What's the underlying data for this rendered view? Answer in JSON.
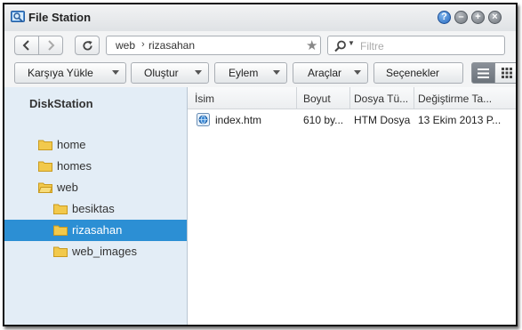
{
  "window": {
    "title": "File Station"
  },
  "nav": {
    "path": [
      "web",
      "rizasahan"
    ],
    "search_placeholder": "Filtre"
  },
  "toolbar": {
    "upload_label": "Karşıya Yükle",
    "create_label": "Oluştur",
    "action_label": "Eylem",
    "tools_label": "Araçlar",
    "settings_label": "Seçenekler"
  },
  "sidebar": {
    "root": "DiskStation",
    "items": [
      {
        "label": "home"
      },
      {
        "label": "homes"
      },
      {
        "label": "web"
      },
      {
        "label": "besiktas"
      },
      {
        "label": "rizasahan"
      },
      {
        "label": "web_images"
      }
    ]
  },
  "files": {
    "columns": [
      "İsim",
      "Boyut",
      "Dosya Tü...",
      "Değiştirme Ta..."
    ],
    "rows": [
      {
        "name": "index.htm",
        "size": "610 by...",
        "type": "HTM Dosya",
        "modified": "13 Ekim 2013 P..."
      }
    ]
  },
  "icons": {
    "app": "file-station-icon",
    "help": "help-icon",
    "minimize": "minimize-icon",
    "maximize": "maximize-icon",
    "close": "close-icon",
    "back": "back-arrow-icon",
    "forward": "forward-arrow-icon",
    "refresh": "refresh-icon",
    "bookmark": "star-icon",
    "search": "search-icon",
    "list_view": "list-view-icon",
    "thumb_view": "thumbnail-view-icon",
    "folder": "folder-icon",
    "html_file": "html-file-icon"
  },
  "colors": {
    "selection": "#2c8fd4",
    "sidebar_bg": "#e3edf6",
    "help_button": "#2a6bc0"
  }
}
